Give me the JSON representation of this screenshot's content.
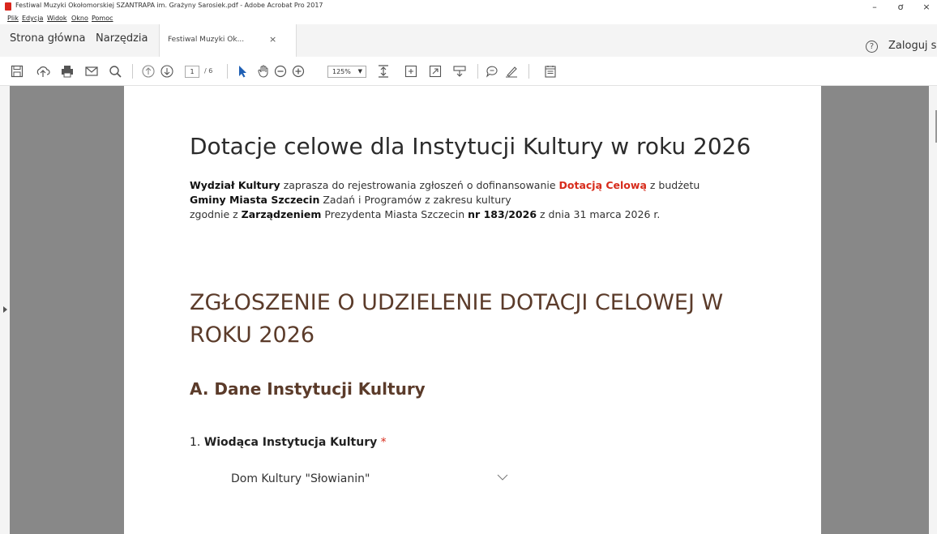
{
  "window": {
    "title": "Festiwal Muzyki Okołomorskiej SZANTRAPA im. Grażyny Sarosiek.pdf - Adobe Acrobat Pro 2017",
    "minimize": "–",
    "maximize": "ơ",
    "close": "×"
  },
  "menu": {
    "items": [
      {
        "label": "Plik"
      },
      {
        "label": "Edycja"
      },
      {
        "label": "Widok"
      },
      {
        "label": "Okno"
      },
      {
        "label": "Pomoc"
      }
    ]
  },
  "tabs": {
    "home": "Strona główna",
    "tools": "Narzędzia",
    "document": "Festiwal Muzyki Ok...",
    "close": "×",
    "help": "?",
    "login": "Zaloguj si"
  },
  "toolbar": {
    "page_current": "1",
    "page_total": "/ 6",
    "zoom": "125%",
    "icons": [
      "save-icon",
      "upload-icon",
      "print-icon",
      "mail-icon",
      "search-icon",
      "prev-page-icon",
      "next-page-icon",
      "select-arrow-icon",
      "hand-icon",
      "zoom-out-icon",
      "zoom-in-icon",
      "fit-page-icon",
      "rotate-icon",
      "fullscreen-icon",
      "read-mode-icon",
      "comment-icon",
      "sign-icon",
      "form-icon"
    ]
  },
  "document": {
    "title": "Dotacje celowe dla Instytucji Kultury w roku 2026",
    "intro": {
      "p1_bold": "Wydział Kultury",
      "p1_text": " zaprasza do rejestrowania zgłoszeń o dofinansowanie ",
      "p1_red": "Dotacją Celową",
      "p2_text": " z budżetu ",
      "p2_bold": "Gminy Miasta Szczecin",
      "p2_text2": " Zadań i Programów z zakresu kultury",
      "p3_text": "zgodnie z ",
      "p3_bold": "Zarządzeniem",
      "p3_text2": " Prezydenta Miasta Szczecin ",
      "p3_bold2": "nr 183/2026",
      "p3_text3": " z dnia 31 marca 2026 r."
    },
    "form_heading": "ZGŁOSZENIE O UDZIELENIE DOTACJI CELOWEJ W ROKU 2026",
    "section_heading": "A. Dane Instytucji Kultury",
    "question_number": "1. ",
    "question_label": "Wiodąca Instytucja Kultury",
    "required_mark": " *",
    "dropdown_value": "Dom Kultury \"Słowianin\""
  },
  "colors": {
    "accent_red": "#d72b1b",
    "heading_brown": "#5b3b2a",
    "viewer_gray": "#888888"
  }
}
